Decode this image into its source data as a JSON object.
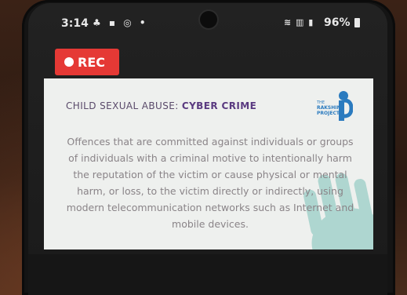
{
  "status_bar": {
    "time": "3:14",
    "left_icons": "♣ ▪ ◎ •",
    "right_icons": "≋ ▥ ▮",
    "battery": "96%"
  },
  "recording": {
    "label": "REC",
    "color": "#e53935"
  },
  "card": {
    "heading_prefix": "CHILD SEXUAL ABUSE: ",
    "heading_strong": "CYBER CRIME",
    "body": "Offences that are committed against individuals or groups of individuals with a criminal motive to intentionally harm the reputation of the victim or cause physical or mental harm, or loss, to the victim directly or indirectly, using modern telecommunication networks such as Internet and mobile devices.",
    "logo": {
      "text_line1": "THE",
      "text_line2": "RAKSHIN",
      "text_line3": "PROJECT",
      "accent": "#2b7bbf"
    },
    "handprint_color": "#9fd0c9"
  }
}
